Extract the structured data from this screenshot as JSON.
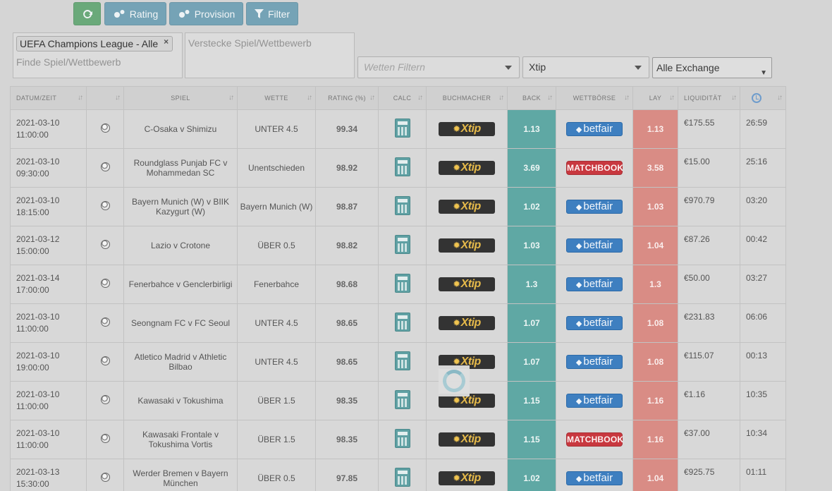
{
  "toolbar": {
    "rating_label": "Rating",
    "provision_label": "Provision",
    "filter_label": "Filter"
  },
  "filters": {
    "competition_tag": "UEFA Champions League - Alle",
    "competition_placeholder": "Finde Spiel/Wettbewerb",
    "hide_placeholder": "Verstecke Spiel/Wettbewerb",
    "bet_filter_placeholder": "Wetten Filtern",
    "bookmaker_selected": "Xtip",
    "exchange_selected": "Alle Exchange"
  },
  "table": {
    "headers": {
      "datetime": "DATUM/ZEIT",
      "game": "SPIEL",
      "bet": "WETTE",
      "rating": "RATING (%)",
      "calc": "CALC",
      "bookmaker": "BUCHMACHER",
      "back": "BACK",
      "exchange": "WETTBÖRSE",
      "lay": "LAY",
      "liquidity": "LIQUIDITÄT"
    },
    "rows": [
      {
        "date": "2021-03-10",
        "time": "11:00:00",
        "game": "C-Osaka v Shimizu",
        "bet": "UNTER 4.5",
        "rating": "99.34",
        "bookmaker": "Xtip",
        "back": "1.13",
        "exchange": "betfair",
        "lay": "1.13",
        "liquidity": "€175.55",
        "countdown": "26:59"
      },
      {
        "date": "2021-03-10",
        "time": "09:30:00",
        "game": "Roundglass Punjab FC v Mohammedan SC",
        "bet": "Unentschieden",
        "rating": "98.92",
        "bookmaker": "Xtip",
        "back": "3.69",
        "exchange": "MATCHBOOK",
        "lay": "3.58",
        "liquidity": "€15.00",
        "countdown": "25:16"
      },
      {
        "date": "2021-03-10",
        "time": "18:15:00",
        "game": "Bayern Munich (W) v BIIK Kazygurt (W)",
        "bet": "Bayern Munich (W)",
        "rating": "98.87",
        "bookmaker": "Xtip",
        "back": "1.02",
        "exchange": "betfair",
        "lay": "1.03",
        "liquidity": "€970.79",
        "countdown": "03:20"
      },
      {
        "date": "2021-03-12",
        "time": "15:00:00",
        "game": "Lazio v Crotone",
        "bet": "ÜBER 0.5",
        "rating": "98.82",
        "bookmaker": "Xtip",
        "back": "1.03",
        "exchange": "betfair",
        "lay": "1.04",
        "liquidity": "€87.26",
        "countdown": "00:42"
      },
      {
        "date": "2021-03-14",
        "time": "17:00:00",
        "game": "Fenerbahce v Genclerbirligi",
        "bet": "Fenerbahce",
        "rating": "98.68",
        "bookmaker": "Xtip",
        "back": "1.3",
        "exchange": "betfair",
        "lay": "1.3",
        "liquidity": "€50.00",
        "countdown": "03:27"
      },
      {
        "date": "2021-03-10",
        "time": "11:00:00",
        "game": "Seongnam FC v FC Seoul",
        "bet": "UNTER 4.5",
        "rating": "98.65",
        "bookmaker": "Xtip",
        "back": "1.07",
        "exchange": "betfair",
        "lay": "1.08",
        "liquidity": "€231.83",
        "countdown": "06:06"
      },
      {
        "date": "2021-03-10",
        "time": "19:00:00",
        "game": "Atletico Madrid v Athletic Bilbao",
        "bet": "UNTER 4.5",
        "rating": "98.65",
        "bookmaker": "Xtip",
        "back": "1.07",
        "exchange": "betfair",
        "lay": "1.08",
        "liquidity": "€115.07",
        "countdown": "00:13"
      },
      {
        "date": "2021-03-10",
        "time": "11:00:00",
        "game": "Kawasaki v Tokushima",
        "bet": "ÜBER 1.5",
        "rating": "98.35",
        "bookmaker": "Xtip",
        "back": "1.15",
        "exchange": "betfair",
        "lay": "1.16",
        "liquidity": "€1.16",
        "countdown": "10:35"
      },
      {
        "date": "2021-03-10",
        "time": "11:00:00",
        "game": "Kawasaki Frontale v Tokushima Vortis",
        "bet": "ÜBER 1.5",
        "rating": "98.35",
        "bookmaker": "Xtip",
        "back": "1.15",
        "exchange": "MATCHBOOK",
        "lay": "1.16",
        "liquidity": "€37.00",
        "countdown": "10:34"
      },
      {
        "date": "2021-03-13",
        "time": "15:30:00",
        "game": "Werder Bremen v Bayern München",
        "bet": "ÜBER 0.5",
        "rating": "97.85",
        "bookmaker": "Xtip",
        "back": "1.02",
        "exchange": "betfair",
        "lay": "1.04",
        "liquidity": "€925.75",
        "countdown": "01:11"
      }
    ]
  },
  "colors": {
    "back": "#5fa8a4",
    "lay": "#d98c85",
    "refresh": "#6aa97a",
    "toolbar": "#75a3b6"
  }
}
